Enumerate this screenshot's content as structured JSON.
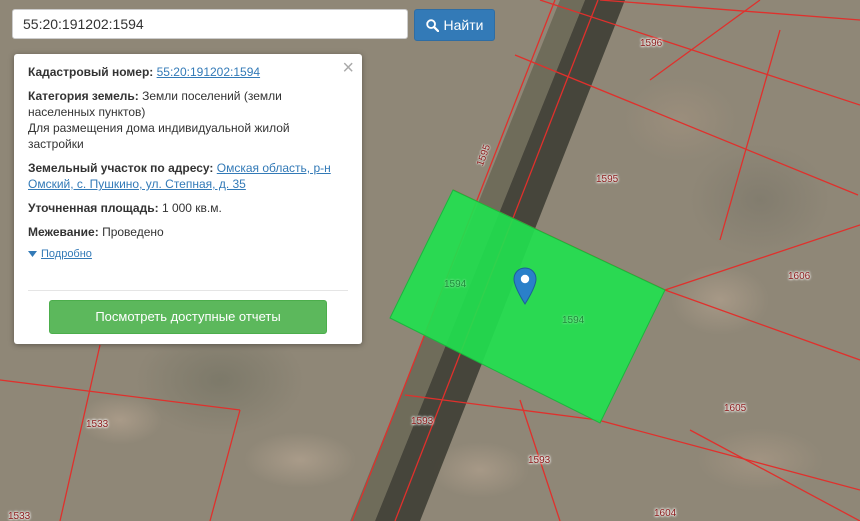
{
  "search": {
    "value": "55:20:191202:1594",
    "button_label": "Найти"
  },
  "popup": {
    "cadastral": {
      "label": "Кадастровый номер:",
      "value": "55:20:191202:1594"
    },
    "category": {
      "label": "Категория земель:",
      "value_inline": "Земли поселений (земли населенных пунктов)",
      "purpose": "Для размещения дома индивидуальной жилой застройки"
    },
    "address": {
      "label": "Земельный участок по адресу:",
      "value": "Омская область, р-н Омский, с. Пушкино, ул. Степная, д. 35"
    },
    "area": {
      "label": "Уточненная площадь:",
      "value": "1 000 кв.м."
    },
    "survey": {
      "label": "Межевание:",
      "value": "Проведено"
    },
    "more_label": "Подробно",
    "report_button": "Посмотреть доступные отчеты",
    "close_symbol": "×"
  },
  "map": {
    "parcel_labels": [
      "1596",
      "1595",
      "1595",
      "1594",
      "1594",
      "1606",
      "1605",
      "1593",
      "1593",
      "1533",
      "1604",
      "1533"
    ],
    "highlight_color": "#22e04f",
    "boundary_color": "#e0302c"
  },
  "icons": {
    "search": "search-icon",
    "marker": "map-marker-icon",
    "caret": "caret-down-icon",
    "close": "close-icon"
  }
}
